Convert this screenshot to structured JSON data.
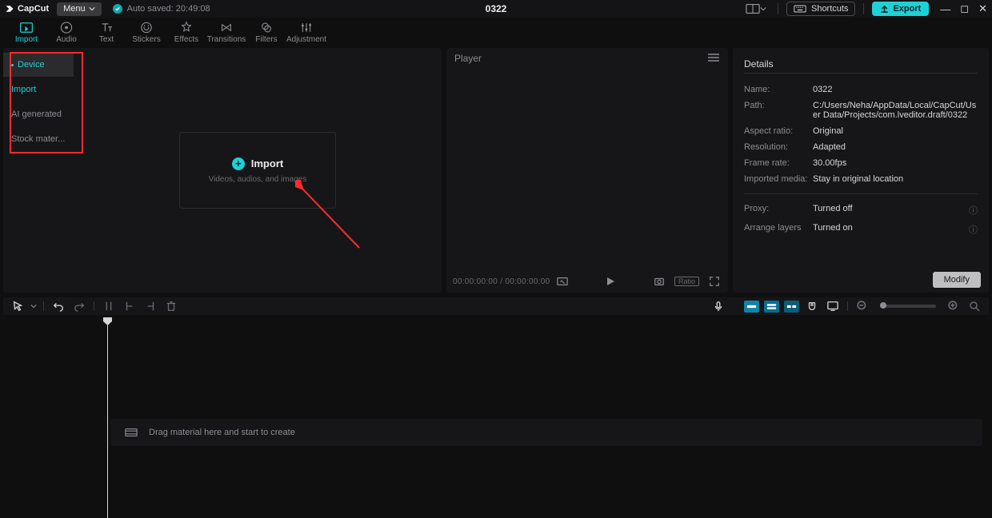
{
  "topbar": {
    "app": "CapCut",
    "menu": "Menu",
    "autosave": "Auto saved: 20:49:08",
    "project": "0322",
    "shortcuts": "Shortcuts",
    "export": "Export"
  },
  "tabs": [
    {
      "label": "Import"
    },
    {
      "label": "Audio"
    },
    {
      "label": "Text"
    },
    {
      "label": "Stickers"
    },
    {
      "label": "Effects"
    },
    {
      "label": "Transitions"
    },
    {
      "label": "Filters"
    },
    {
      "label": "Adjustment"
    }
  ],
  "sidebar": {
    "items": [
      {
        "label": "Device"
      },
      {
        "label": "Import"
      },
      {
        "label": "AI generated"
      },
      {
        "label": "Stock mater..."
      }
    ]
  },
  "import": {
    "title": "Import",
    "sub": "Videos, audios, and images"
  },
  "player": {
    "title": "Player",
    "time": "00:00:00:00 / 00:00:00:00",
    "ratio": "Ratio"
  },
  "details": {
    "title": "Details",
    "rows": [
      {
        "k": "Name:",
        "v": "0322"
      },
      {
        "k": "Path:",
        "v": "C:/Users/Neha/AppData/Local/CapCut/User Data/Projects/com.lveditor.draft/0322"
      },
      {
        "k": "Aspect ratio:",
        "v": "Original"
      },
      {
        "k": "Resolution:",
        "v": "Adapted"
      },
      {
        "k": "Frame rate:",
        "v": "30.00fps"
      },
      {
        "k": "Imported media:",
        "v": "Stay in original location"
      }
    ],
    "rows2": [
      {
        "k": "Proxy:",
        "v": "Turned off"
      },
      {
        "k": "Arrange layers",
        "v": "Turned on"
      }
    ],
    "modify": "Modify"
  },
  "timeline": {
    "hint": "Drag material here and start to create"
  }
}
